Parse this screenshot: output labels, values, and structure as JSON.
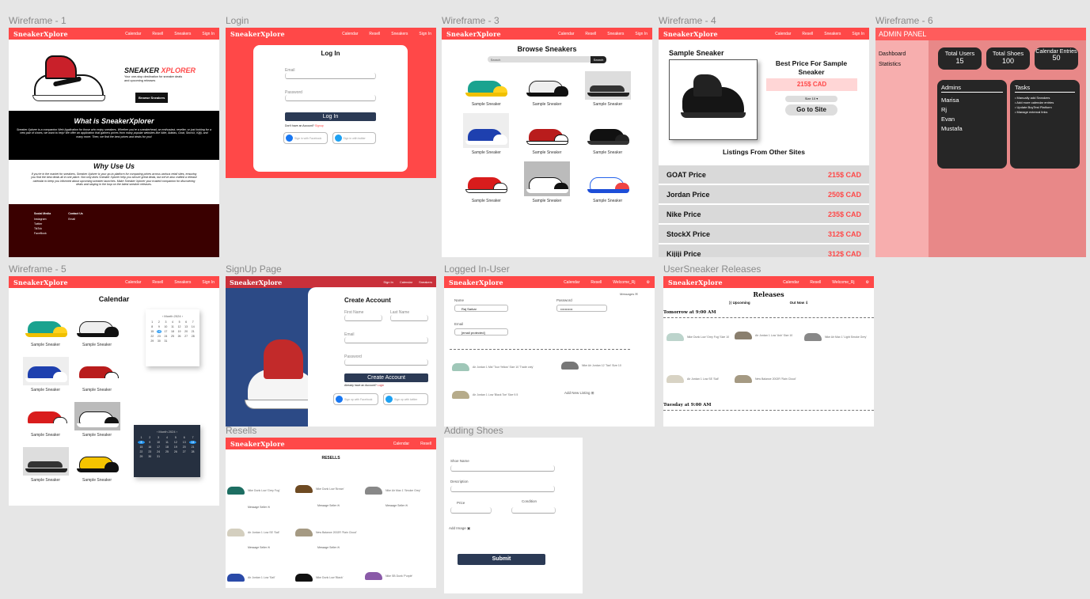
{
  "labels": {
    "wf1": "Wireframe - 1",
    "login": "Login",
    "wf3": "Wireframe - 3",
    "wf4": "Wireframe - 4",
    "wf6": "Wireframe - 6",
    "wf5": "Wireframe - 5",
    "signup": "SignUp Page",
    "logged": "Logged In-User",
    "usersneaker": "UserSneaker Releases",
    "resells": "Resells",
    "adding": "Adding Shoes"
  },
  "nav": {
    "logo": "SneakerXplore",
    "calendar": "Calendar",
    "resell": "Resell",
    "sneakers": "Sneakers",
    "signin": "Sign In",
    "welcome": "Welcome_Rj"
  },
  "wf1": {
    "hero_title_a": "SNEAKER ",
    "hero_title_b": "XPLORER",
    "hero_sub": "Your one-stop destination for sneaker deals and upcoming releases",
    "browse_btn": "Browse Sneakers",
    "what_title": "What is SneakerXplorer",
    "what_body": "Sneaker Xplorer is a companion Web Application for those who enjoy sneakers. Whether you're a sneakerhead, an enthusiast, reseller, or just looking for a new pair of shoes, we want to help! We offer an application that gathers prices from many popular websites like Nike, Adidas, Goat, StockX, Kijiji, and many more. Then, we find the best prices and deals for you!",
    "why_title": "Why Use Us",
    "why_body": "If you're in the market for sneakers, Sneaker Xplorer is your go-to platform for comparing prices across various retail sites, ensuring you find the best deals all in one place. Not only does Sneaker Xplorer help you secure great deals, but we've also crafted a release calendar to keep you informed about upcoming sneaker launches. Make Sneaker Xplorer your trusted companion for discovering deals and staying in the loop on the latest sneaker releases.",
    "footer": {
      "social_title": "Social Media",
      "social": [
        "Instagram",
        "Twitter",
        "TikTok",
        "FaceBook"
      ],
      "contact_title": "Contact Us",
      "contact": [
        "Email"
      ]
    }
  },
  "login": {
    "title": "Log In",
    "email": "Email",
    "password": "Password",
    "button": "Log In",
    "no_account": "Don't have an Account?",
    "signup_link": "Signup",
    "facebook": "Sign in with Facebook",
    "twitter": "Sign in with twitter"
  },
  "wf3": {
    "title": "Browse Sneakers",
    "search_placeholder": "Search",
    "search_btn": "Search",
    "items": [
      "Sample Sneaker",
      "Sample Sneaker",
      "Sample Sneaker",
      "Sample Sneaker",
      "Sample Sneaker",
      "Sample Sneaker",
      "Sample Sneaker",
      "Sample Sneaker",
      "Sample Sneaker"
    ]
  },
  "wf4": {
    "title": "Sample Sneaker",
    "best_price": "Best Price For Sample Sneaker",
    "price": "215$ CAD",
    "size": "Size 10",
    "go": "Go to Site",
    "listings": "Listings From Other Sites",
    "prices": [
      {
        "site": "GOAT Price",
        "price": "215$ CAD"
      },
      {
        "site": "Jordan Price",
        "price": "250$ CAD"
      },
      {
        "site": "Nike Price",
        "price": "235$ CAD"
      },
      {
        "site": "StockX Price",
        "price": "312$ CAD"
      },
      {
        "site": "Kijiji Price",
        "price": "312$ CAD"
      }
    ]
  },
  "wf6": {
    "header": "ADMIN PANEL",
    "side": [
      "Dashboard",
      "Statistics"
    ],
    "stats": [
      {
        "label": "Total Users",
        "value": "15"
      },
      {
        "label": "Total Shoes",
        "value": "100"
      },
      {
        "label": "Calendar Entries",
        "value": "50"
      }
    ],
    "admins_title": "Admins",
    "admins": [
      "Marisa",
      "Rj",
      "Evan",
      "Mustafa"
    ],
    "tasks_title": "Tasks",
    "tasks": [
      "Manually add Sneakers",
      "Add more calendar entries",
      "Update BuyTest Platform",
      "Manage external links"
    ]
  },
  "wf5": {
    "title": "Calendar",
    "items": [
      "Sample Sneaker",
      "Sample Sneaker",
      "Sample Sneaker",
      "Sample Sneaker",
      "Sample Sneaker",
      "Sample Sneaker",
      "Sample Sneaker",
      "Sample Sneaker"
    ],
    "month": "Month 2024"
  },
  "signup": {
    "title": "Create Account",
    "first": "First Name",
    "last": "Last Name",
    "email": "Email",
    "password": "Password",
    "button": "Create Account",
    "have_account": "Already have an Account?",
    "login_link": "Login",
    "facebook": "Sign up with Facebook",
    "twitter": "Sign up with twitter"
  },
  "logged": {
    "name_label": "Name",
    "name_value": "Raj Sarkar",
    "password_label": "Password",
    "password_value": "•••••••••••",
    "email_label": "Email",
    "email_value": "[email protected]",
    "messages": "Messages",
    "listings": [
      "Air Jordan 1 Mid 'Tour Yellow' Size 10 'Trade only'",
      "Nike Air Jordan 12 'Taxi' Size 10",
      "Air Jordan 1 Low 'Black Toe' Size 9.5"
    ],
    "add_new": "Add New Listing"
  },
  "usersneaker": {
    "title": "Releases",
    "upcoming": "Upcoming",
    "outnow": "Out Now",
    "day1": "Tomorrow at 9:00 AM",
    "day2": "Tuesday at 9:00 AM",
    "items": [
      "Nike Dunk Low 'Grey Fog' Size 10",
      "Air Jordan 1 Low 'Ash' Size 10",
      "Nike Air Max 1 'Light Smoke Grey'",
      "Air Jordan 1 Low SE 'Sail'",
      "New Balance 2002R 'Rain Cloud'"
    ]
  },
  "resells": {
    "title": "RESELLS",
    "items": [
      {
        "name": "Nike Dunk Low 'Grey Fog'",
        "msg": "Message Seller"
      },
      {
        "name": "Nike Dunk Low 'Brown'",
        "msg": "Message Seller"
      },
      {
        "name": "Nike Air Max 1 'Smoke Grey'",
        "msg": "Message Seller"
      },
      {
        "name": "Air Jordan 1 Low SE 'Sail'",
        "msg": "Message Seller"
      },
      {
        "name": "New Balance 2002R 'Rain Cloud'",
        "msg": "Message Seller"
      },
      {
        "name": "Air Jordan 1 Low 'Sail'",
        "msg": ""
      },
      {
        "name": "Nike Dunk Low 'Black'",
        "msg": ""
      },
      {
        "name": "Nike SB Dunk 'Purple'",
        "msg": ""
      }
    ]
  },
  "adding": {
    "name": "Shoe Name",
    "description": "Description",
    "price": "Price",
    "condition": "Condition",
    "image": "Add Image",
    "submit": "Submit"
  },
  "colors": {
    "brand": "#ff4848",
    "admin": "#f39b9b",
    "button": "#2b3a55"
  }
}
